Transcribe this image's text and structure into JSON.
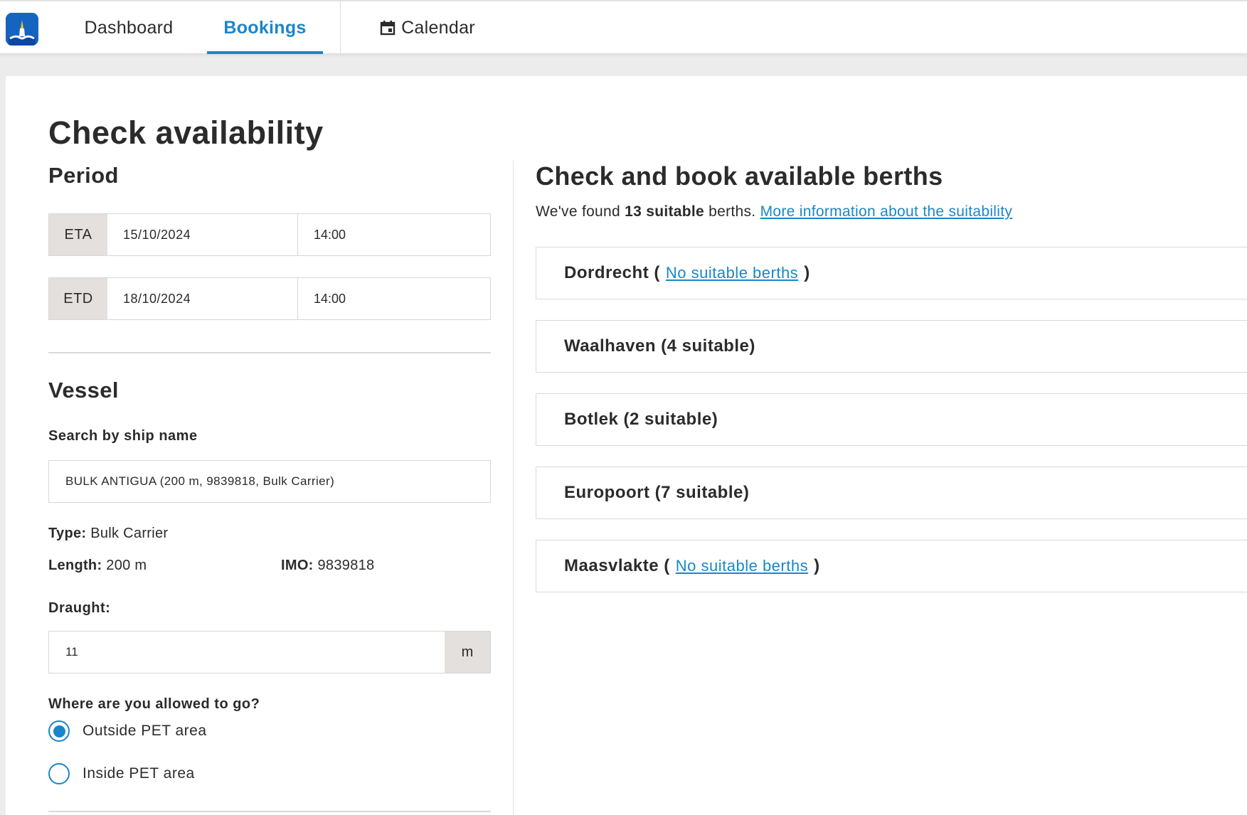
{
  "nav": {
    "logo_icon": "harbor-logo-icon",
    "tabs": [
      {
        "label": "Dashboard"
      },
      {
        "label": "Bookings"
      },
      {
        "label": "Calendar",
        "icon": "calendar-icon"
      }
    ],
    "active_tab": "Bookings",
    "accent": "#1a86c8"
  },
  "page": {
    "title": "Check availability"
  },
  "period": {
    "title": "Period",
    "eta": {
      "label": "ETA",
      "date": "15/10/2024",
      "time": "14:00"
    },
    "etd": {
      "label": "ETD",
      "date": "18/10/2024",
      "time": "14:00"
    }
  },
  "vessel": {
    "title": "Vessel",
    "search_label": "Search by ship name",
    "search_value": "BULK ANTIGUA (200 m, 9839818, Bulk Carrier)",
    "type_label": "Type:",
    "type_value": "Bulk Carrier",
    "length_label": "Length:",
    "length_value": "200 m",
    "imo_label": "IMO:",
    "imo_value": "9839818",
    "draught_label": "Draught:",
    "draught_value": "11",
    "draught_unit": "m",
    "allowed_label": "Where are you allowed to go?",
    "options": [
      {
        "label": "Outside PET area",
        "selected": true
      },
      {
        "label": "Inside PET area",
        "selected": false
      }
    ]
  },
  "berths": {
    "title": "Check and book available berths",
    "found_prefix": "We've found",
    "found_count": "13 suitable",
    "found_suffix": "berths.",
    "info_link": "More information about the suitability",
    "areas": [
      {
        "name": "Dordrecht",
        "open": "(",
        "link": "No suitable berths",
        "close": ")"
      },
      {
        "name": "Waalhaven (4 suitable)"
      },
      {
        "name": "Botlek (2 suitable)"
      },
      {
        "name": "Europoort (7 suitable)"
      },
      {
        "name": "Maasvlakte",
        "open": "(",
        "link": "No suitable berths",
        "close": ")"
      }
    ]
  }
}
